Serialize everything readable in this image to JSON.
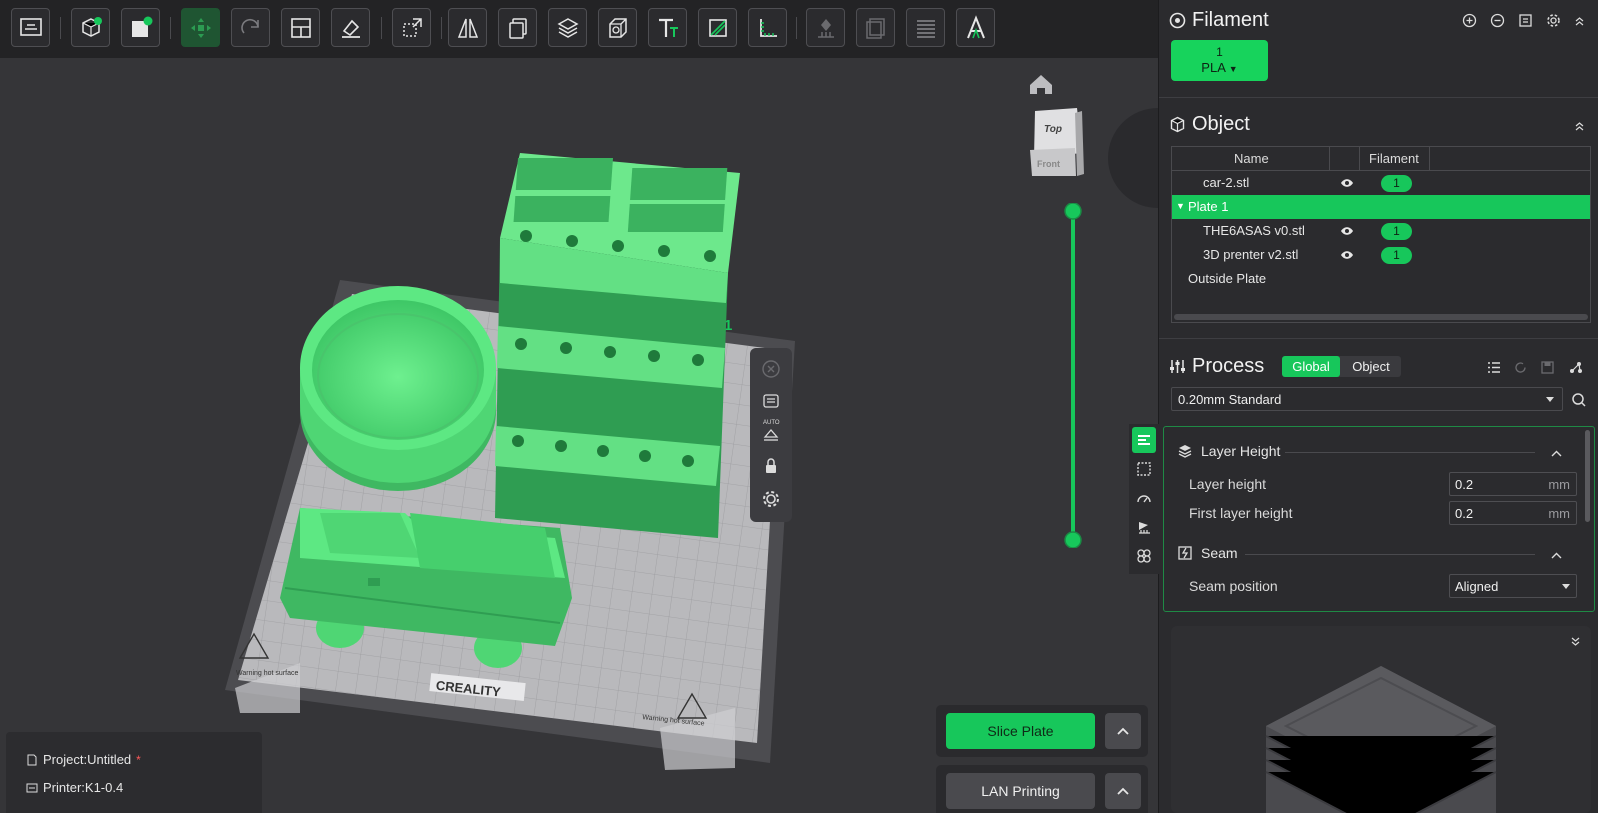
{
  "toolbar": {
    "buttons": [
      {
        "name": "add-plate-button",
        "icon": "plate-icon"
      },
      {
        "name": "add-object-button",
        "icon": "cube-add-icon"
      },
      {
        "name": "add-part-button",
        "icon": "part-add-icon"
      },
      {
        "name": "auto-orient-button",
        "icon": "move-icon",
        "active": true
      },
      {
        "name": "arrange-button",
        "icon": "arrange-icon"
      },
      {
        "name": "layout-button",
        "icon": "layout-icon"
      },
      {
        "name": "lay-on-face-button",
        "icon": "flatten-icon"
      },
      {
        "name": "scale-button",
        "icon": "scale-icon"
      },
      {
        "name": "mirror-button",
        "icon": "mirror-icon"
      },
      {
        "name": "copy-button",
        "icon": "copy-icon"
      },
      {
        "name": "split-button",
        "icon": "layers-icon"
      },
      {
        "name": "cut-button",
        "icon": "box-icon"
      },
      {
        "name": "text-button",
        "icon": "text-icon"
      },
      {
        "name": "paint-button",
        "icon": "slash-icon"
      },
      {
        "name": "measure-button",
        "icon": "ruler-icon"
      },
      {
        "name": "support-paint-button",
        "icon": "support-icon"
      },
      {
        "name": "seam-paint-button",
        "icon": "seam-icon"
      },
      {
        "name": "layer-view-button",
        "icon": "stack-icon"
      },
      {
        "name": "assembly-button",
        "icon": "letter-a-icon"
      }
    ]
  },
  "viewport": {
    "nav_cube": {
      "top": "Top",
      "front": "Front"
    },
    "plate_index": "1",
    "bed_brand": "CREALITY",
    "bed_warning": "Warning hot surface",
    "auto_label": "AUTO",
    "project": {
      "label": "Project:Untitled",
      "unsaved_mark": "*"
    },
    "printer": {
      "label": "Printer:K1-0.4"
    },
    "slice_button": "Slice Plate",
    "lan_button": "LAN Printing"
  },
  "filament": {
    "title": "Filament",
    "slot": {
      "index": "1",
      "type": "PLA"
    }
  },
  "object": {
    "title": "Object",
    "columns": {
      "name": "Name",
      "filament": "Filament"
    },
    "rows": [
      {
        "name": "car-2.stl",
        "filament": "1",
        "indent": 1
      },
      {
        "name": "Plate 1",
        "filament": "",
        "indent": 0,
        "selected": true
      },
      {
        "name": "THE6ASAS v0.stl",
        "filament": "1",
        "indent": 1
      },
      {
        "name": "3D prenter v2.stl",
        "filament": "1",
        "indent": 1
      },
      {
        "name": "Outside Plate",
        "filament": "",
        "indent": 0
      }
    ]
  },
  "process": {
    "title": "Process",
    "toggle": {
      "global": "Global",
      "object": "Object"
    },
    "preset": "0.20mm Standard",
    "groups": {
      "layer_height": {
        "title": "Layer Height",
        "layer_height": {
          "label": "Layer height",
          "value": "0.2",
          "unit": "mm"
        },
        "first_layer_height": {
          "label": "First layer height",
          "value": "0.2",
          "unit": "mm"
        }
      },
      "seam": {
        "title": "Seam",
        "seam_position": {
          "label": "Seam position",
          "value": "Aligned"
        }
      }
    }
  },
  "colors": {
    "accent": "#17c75b",
    "panel": "#2b2b2e",
    "viewport": "#353538"
  }
}
